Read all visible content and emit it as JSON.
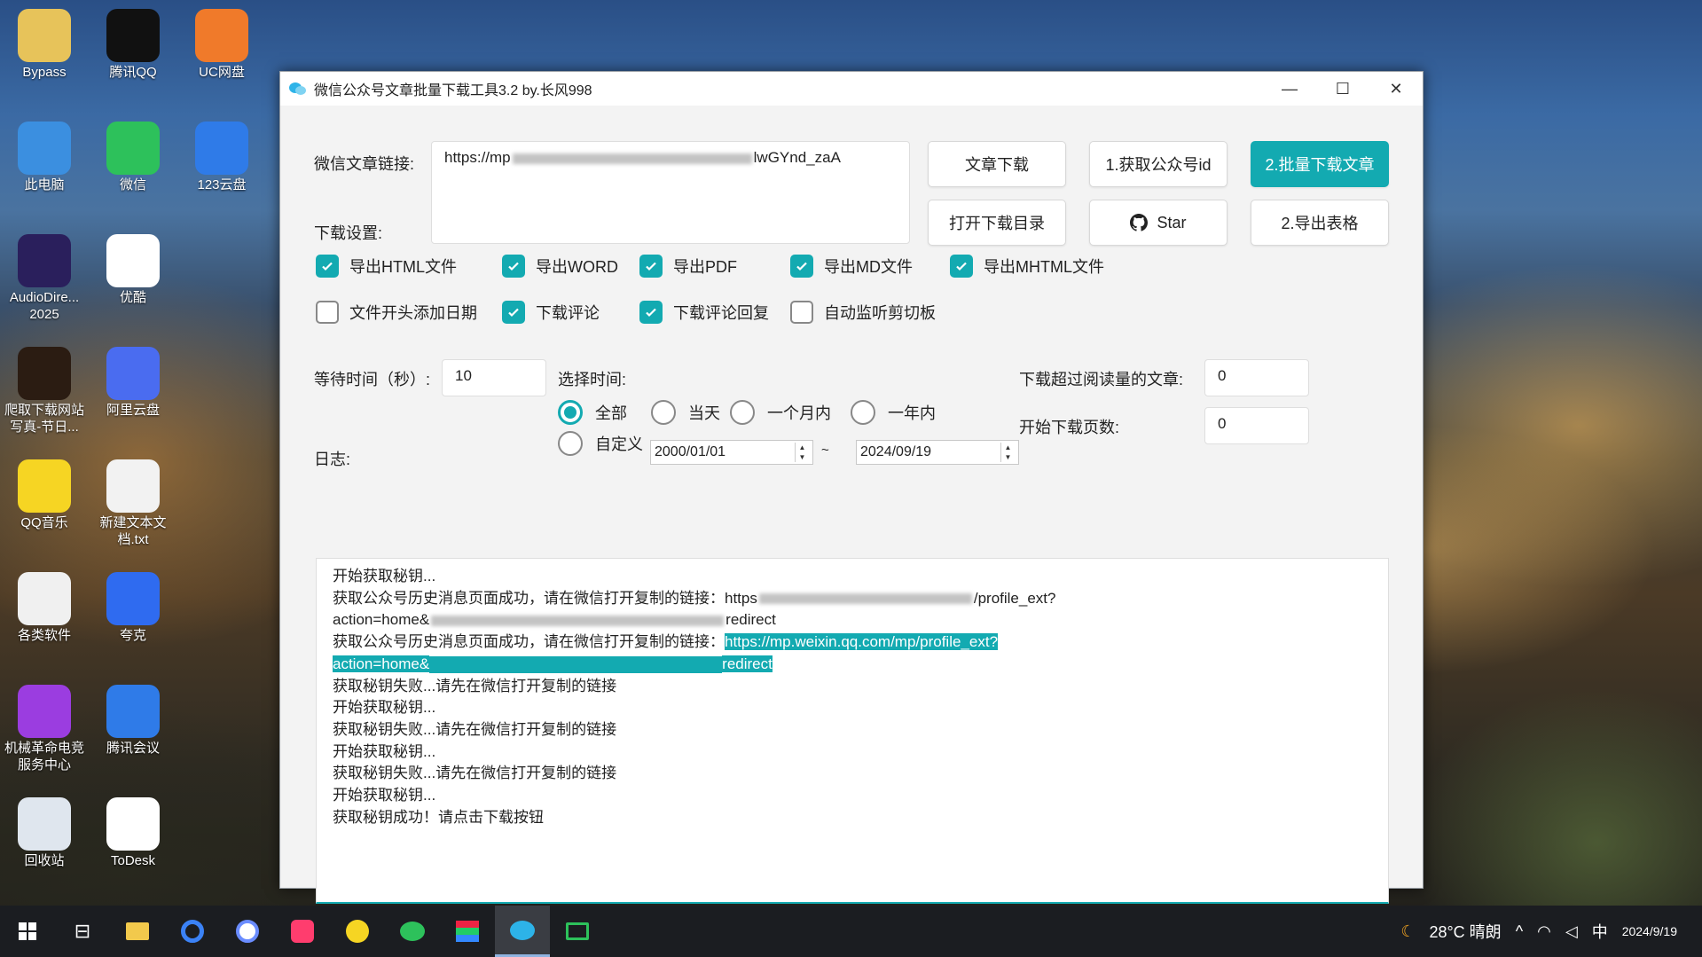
{
  "desktop": {
    "icons": [
      {
        "label": "Bypass",
        "icon": "folder-icon",
        "color": "#e7c35a"
      },
      {
        "label": "腾讯QQ",
        "icon": "qq-icon",
        "color": "#111111"
      },
      {
        "label": "UC网盘",
        "icon": "uc-drive-icon",
        "color": "#f07a2a"
      },
      {
        "label": "此电脑",
        "icon": "computer-icon",
        "color": "#3b8fe0"
      },
      {
        "label": "微信",
        "icon": "wechat-icon",
        "color": "#2dc15b"
      },
      {
        "label": "123云盘",
        "icon": "123-cloud-icon",
        "color": "#2f7be8"
      },
      {
        "label": "AudioDire... 2025",
        "icon": "audiodirector-icon",
        "color": "#2a1f5c"
      },
      {
        "label": "优酷",
        "icon": "youku-icon",
        "color": "#ffffff"
      },
      {
        "label": "爬取下载网站写真-节日...",
        "icon": "book-icon",
        "color": "#2b1c12"
      },
      {
        "label": "阿里云盘",
        "icon": "aliyun-drive-icon",
        "color": "#4a6cf0"
      },
      {
        "label": "QQ音乐",
        "icon": "qq-music-icon",
        "color": "#f6d523"
      },
      {
        "label": "新建文本文档.txt",
        "icon": "text-file-icon",
        "color": "#f2f2f2"
      },
      {
        "label": "各类软件",
        "icon": "folder-icon",
        "color": "#f0f0f0"
      },
      {
        "label": "夸克",
        "icon": "quark-icon",
        "color": "#2f6bf0"
      },
      {
        "label": "机械革命电竞服务中心",
        "icon": "mechrevo-icon",
        "color": "#9b3de0"
      },
      {
        "label": "腾讯会议",
        "icon": "tencent-meeting-icon",
        "color": "#2f7be8"
      },
      {
        "label": "回收站",
        "icon": "recycle-bin-icon",
        "color": "#dfe6ee"
      },
      {
        "label": "ToDesk",
        "icon": "todesk-icon",
        "color": "#ffffff"
      }
    ]
  },
  "window": {
    "title": "微信公众号文章批量下载工具3.2 by.长风998",
    "minimize": "—",
    "maximize": "☐",
    "close": "✕"
  },
  "form": {
    "url_label": "微信文章链接:",
    "url_value_start": "https://mp",
    "url_value_end": "lwGYnd_zaA",
    "settings_label": "下载设置:",
    "wait_label": "等待时间（秒）:",
    "wait_value": "10",
    "time_label": "选择时间:",
    "read_threshold_label": "下载超过阅读量的文章:",
    "read_threshold_value": "0",
    "start_page_label": "开始下载页数:",
    "start_page_value": "0",
    "log_label": "日志:"
  },
  "buttons": {
    "download_article": "文章下载",
    "get_account_id": "1.获取公众号id",
    "batch_download": "2.批量下载文章",
    "open_dir": "打开下载目录",
    "star": "Star",
    "export_table": "2.导出表格"
  },
  "checkboxes": [
    {
      "label": "导出HTML文件",
      "checked": true
    },
    {
      "label": "导出WORD",
      "checked": true
    },
    {
      "label": "导出PDF",
      "checked": true
    },
    {
      "label": "导出MD文件",
      "checked": true
    },
    {
      "label": "导出MHTML文件",
      "checked": true
    },
    {
      "label": "文件开头添加日期",
      "checked": false
    },
    {
      "label": "下载评论",
      "checked": true
    },
    {
      "label": "下载评论回复",
      "checked": true
    },
    {
      "label": "自动监听剪切板",
      "checked": false
    }
  ],
  "radios": [
    {
      "label": "全部",
      "selected": true
    },
    {
      "label": "当天",
      "selected": false
    },
    {
      "label": "一个月内",
      "selected": false
    },
    {
      "label": "一年内",
      "selected": false
    },
    {
      "label": "自定义",
      "selected": false
    }
  ],
  "dates": {
    "from": "2000/01/01",
    "sep": "~",
    "to": "2024/09/19"
  },
  "log": {
    "lines": [
      "开始获取秘钥...",
      "获取公众号历史消息页面成功，请在微信打开复制的链接：https",
      "action=home&",
      "获取公众号历史消息页面成功，请在微信打开复制的链接：",
      "https://mp.weixin.qq.com/mp/profile_ext?",
      "action=home&",
      "获取秘钥失败...请先在微信打开复制的链接",
      "开始获取秘钥...",
      "获取秘钥失败...请先在微信打开复制的链接",
      "开始获取秘钥...",
      "获取秘钥失败...请先在微信打开复制的链接",
      "开始获取秘钥...",
      "获取秘钥成功！请点击下载按钮"
    ],
    "line2_tail": "/profile_ext?",
    "line3_tail": "redirect"
  },
  "taskbar": {
    "weather": "28°C 晴朗",
    "ime": "中",
    "date": "2024/9/19"
  },
  "colors": {
    "accent": "#13aab1"
  }
}
